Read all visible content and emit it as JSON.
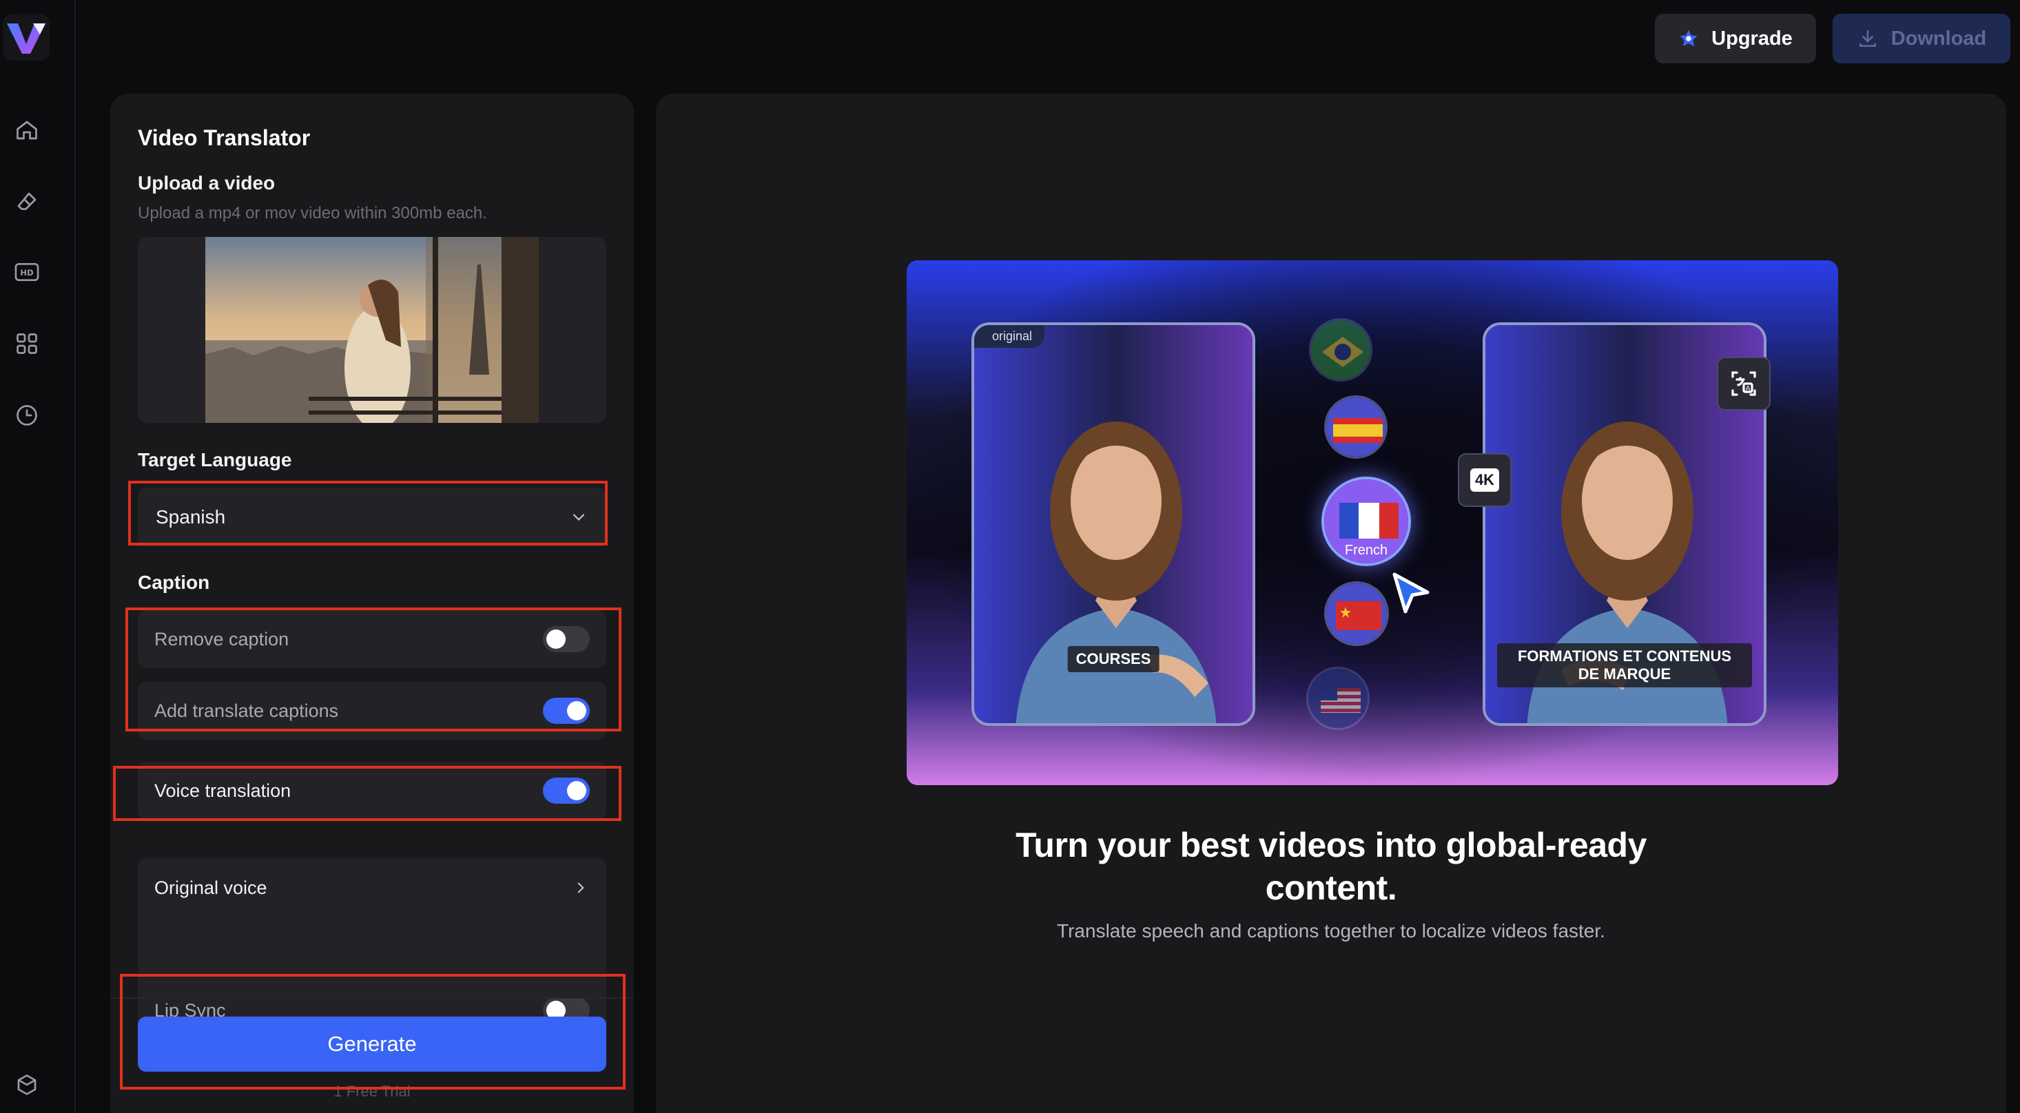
{
  "header": {
    "upgrade_label": "Upgrade",
    "download_label": "Download"
  },
  "panel": {
    "title": "Video Translator",
    "upload_label": "Upload a video",
    "upload_hint": "Upload a mp4 or mov video within 300mb each.",
    "target_language_label": "Target Language",
    "target_language_value": "Spanish",
    "caption_label": "Caption",
    "remove_caption_label": "Remove caption",
    "remove_caption_on": false,
    "add_translate_captions_label": "Add translate captions",
    "add_translate_captions_on": true,
    "voice_translation_label": "Voice translation",
    "voice_translation_on": true,
    "original_voice_label": "Original voice",
    "lip_sync_label": "Lip Sync",
    "lip_sync_on": false,
    "generate_label": "Generate",
    "free_trial_label": "1 Free Trial"
  },
  "banner": {
    "original_tag": "original",
    "left_caption": "COURSES",
    "right_caption": "FORMATIONS ET CONTENUS DE MARQUE",
    "selected_language": "French",
    "badge_4k": "4K"
  },
  "promo": {
    "headline_line1": "Turn your best videos into global-ready",
    "headline_line2": "content.",
    "subline": "Translate speech and captions together to localize videos faster."
  },
  "colors": {
    "accent": "#3a64f5",
    "annotation": "#e2301c"
  }
}
